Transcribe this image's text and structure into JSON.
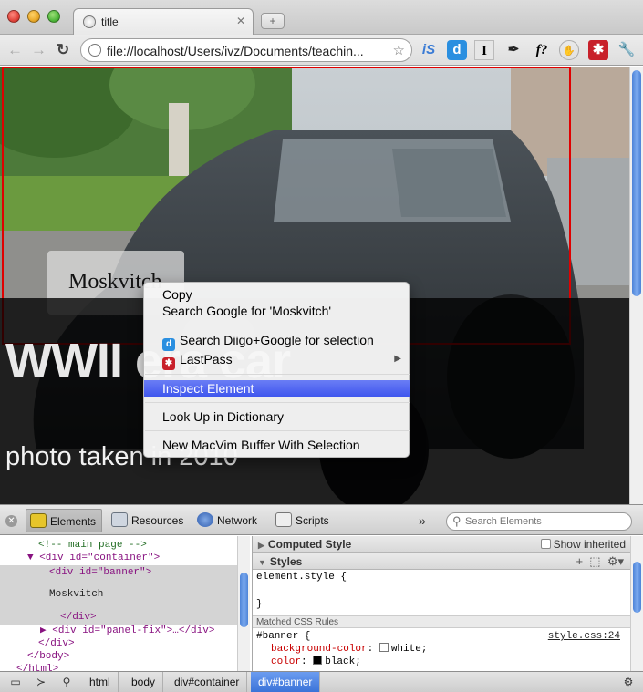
{
  "window": {
    "tab_title": "title",
    "new_tab_symbol": "+"
  },
  "toolbar": {
    "url": "file://localhost/Users/ivz/Documents/teachin...",
    "back_icon": "←",
    "forward_icon": "→",
    "reload_icon": "C",
    "extensions": [
      "iS",
      "d",
      "I",
      "pin-icon",
      "f?",
      "hand-icon",
      "lastpass-icon",
      "wrench-icon"
    ]
  },
  "page": {
    "name_box_text": "Moskvitch",
    "big_title": "WWII era car",
    "caption": "photo taken in 2010",
    "outline_color": "#e00000"
  },
  "context_menu": {
    "items": [
      {
        "label": "Copy"
      },
      {
        "label": "Search Google for 'Moskvitch'"
      },
      {
        "label": "Search Diigo+Google for selection"
      },
      {
        "label": "LastPass"
      },
      {
        "label": "Inspect Element"
      },
      {
        "label": "Look Up in Dictionary"
      },
      {
        "label": "New MacVim Buffer With Selection"
      }
    ],
    "highlight_color": "#3f56ee"
  },
  "devtools": {
    "tabs": [
      {
        "label": "Elements"
      },
      {
        "label": "Resources"
      },
      {
        "label": "Network"
      },
      {
        "label": "Scripts"
      }
    ],
    "more_symbol": "»",
    "search_placeholder": "Search Elements",
    "dom": {
      "comment": "<!-- main page -->",
      "container_open": "<div id=\"container\">",
      "banner_open": "<div id=\"banner\">",
      "text_node": "Moskvitch",
      "div_close": "</div>",
      "panel_fix": "<div id=\"panel-fix\">…</div>",
      "container_close": "</div>",
      "body_close": "</body>",
      "html_close": "</html>"
    },
    "sidebar": {
      "computed_style": "Computed Style",
      "show_inherited": "Show inherited",
      "styles": "Styles",
      "element_style_open": "element.style {",
      "element_style_close": "}",
      "matched_rules": "Matched CSS Rules",
      "rule_selector": "#banner {",
      "rule_source": "style.css:24",
      "props": [
        {
          "name": "background-color",
          "value": "white",
          "swatch": "#ffffff"
        },
        {
          "name": "color",
          "value": "black",
          "swatch": "#000000"
        }
      ]
    },
    "breadcrumbs": [
      "html",
      "body",
      "div#container",
      "div#banner"
    ]
  }
}
